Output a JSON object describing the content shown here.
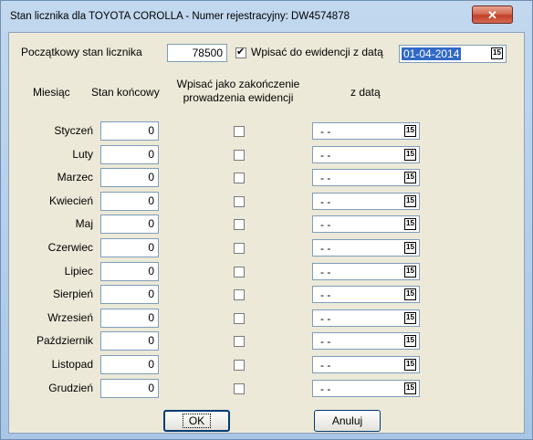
{
  "window": {
    "title": "Stan licznika dla TOYOTA COROLLA - Numer rejestracyjny: DW4574878",
    "close_label": "✕"
  },
  "top": {
    "start_label": "Początkowy stan licznika",
    "start_value": "78500",
    "register_checked": true,
    "register_label": "Wpisać do ewidencji z datą",
    "register_date": "01-04-2014"
  },
  "headers": {
    "month": "Miesiąc",
    "end_state": "Stan końcowy",
    "finish_line1": "Wpisać jako zakończenie",
    "finish_line2": "prowadzenia ewidencji",
    "with_date": "z datą"
  },
  "months": [
    {
      "name": "Styczeń",
      "value": "0",
      "checked": false,
      "date": "- -"
    },
    {
      "name": "Luty",
      "value": "0",
      "checked": false,
      "date": "- -"
    },
    {
      "name": "Marzec",
      "value": "0",
      "checked": false,
      "date": "- -"
    },
    {
      "name": "Kwiecień",
      "value": "0",
      "checked": false,
      "date": "- -"
    },
    {
      "name": "Maj",
      "value": "0",
      "checked": false,
      "date": "- -"
    },
    {
      "name": "Czerwiec",
      "value": "0",
      "checked": false,
      "date": "- -"
    },
    {
      "name": "Lipiec",
      "value": "0",
      "checked": false,
      "date": "- -"
    },
    {
      "name": "Sierpień",
      "value": "0",
      "checked": false,
      "date": "- -"
    },
    {
      "name": "Wrzesień",
      "value": "0",
      "checked": false,
      "date": "- -"
    },
    {
      "name": "Październik",
      "value": "0",
      "checked": false,
      "date": "- -"
    },
    {
      "name": "Listopad",
      "value": "0",
      "checked": false,
      "date": "- -"
    },
    {
      "name": "Grudzień",
      "value": "0",
      "checked": false,
      "date": "- -"
    }
  ],
  "calendar_glyph": "15",
  "buttons": {
    "ok": "OK",
    "cancel": "Anuluj"
  }
}
